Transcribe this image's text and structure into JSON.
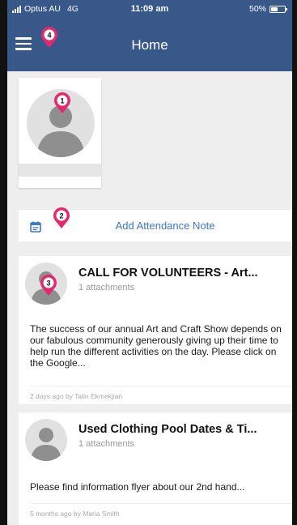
{
  "status_bar": {
    "carrier": "Optus AU",
    "network": "4G",
    "time": "11:09 am",
    "battery": "50%",
    "battery_level": 0.5
  },
  "nav": {
    "title": "Home",
    "menu_icon": "hamburger-menu-icon"
  },
  "attendance": {
    "icon": "calendar-note-icon",
    "label": "Add Attendance Note"
  },
  "posts": [
    {
      "title": "CALL FOR VOLUNTEERS - Art...",
      "attachments": "1 attachments",
      "body": "The success of our annual Art and Craft Show depends on our fabulous community generously giving up their time to help run the different activities on the day. Please click on the Google...",
      "footer": "2 days ago by Talin Ekmekjian"
    },
    {
      "title": "Used Clothing Pool Dates & Ti...",
      "attachments": "1 attachments",
      "body": "Please find information flyer about our 2nd hand...",
      "footer": "5 months ago by Maria Smith"
    }
  ],
  "markers": [
    "1",
    "2",
    "3",
    "4"
  ],
  "colors": {
    "header": "#38588a",
    "link": "#3f76c2",
    "marker": "#e4286e",
    "background": "#eeeeee"
  }
}
